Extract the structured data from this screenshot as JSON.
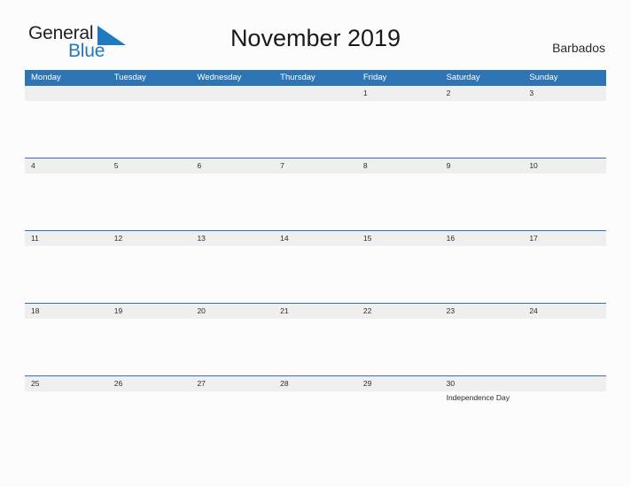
{
  "brand": {
    "name_part1": "General",
    "name_part2": "Blue",
    "flag_icon": "blue-triangle-flag-icon",
    "accent_color": "#1f7ac0"
  },
  "header": {
    "title": "November 2019",
    "locale": "Barbados"
  },
  "theme": {
    "header_blue": "#2e75b6",
    "band_gray": "#efeff0",
    "page_background": "#fcfcfc",
    "text_color": "#2b2b2b"
  },
  "calendar": {
    "month": "November",
    "year": "2019",
    "country": "Barbados",
    "weekdays": [
      "Monday",
      "Tuesday",
      "Wednesday",
      "Thursday",
      "Friday",
      "Saturday",
      "Sunday"
    ],
    "weeks": [
      [
        {
          "day": "",
          "events": []
        },
        {
          "day": "",
          "events": []
        },
        {
          "day": "",
          "events": []
        },
        {
          "day": "",
          "events": []
        },
        {
          "day": "1",
          "events": []
        },
        {
          "day": "2",
          "events": []
        },
        {
          "day": "3",
          "events": []
        }
      ],
      [
        {
          "day": "4",
          "events": []
        },
        {
          "day": "5",
          "events": []
        },
        {
          "day": "6",
          "events": []
        },
        {
          "day": "7",
          "events": []
        },
        {
          "day": "8",
          "events": []
        },
        {
          "day": "9",
          "events": []
        },
        {
          "day": "10",
          "events": []
        }
      ],
      [
        {
          "day": "11",
          "events": []
        },
        {
          "day": "12",
          "events": []
        },
        {
          "day": "13",
          "events": []
        },
        {
          "day": "14",
          "events": []
        },
        {
          "day": "15",
          "events": []
        },
        {
          "day": "16",
          "events": []
        },
        {
          "day": "17",
          "events": []
        }
      ],
      [
        {
          "day": "18",
          "events": []
        },
        {
          "day": "19",
          "events": []
        },
        {
          "day": "20",
          "events": []
        },
        {
          "day": "21",
          "events": []
        },
        {
          "day": "22",
          "events": []
        },
        {
          "day": "23",
          "events": []
        },
        {
          "day": "24",
          "events": []
        }
      ],
      [
        {
          "day": "25",
          "events": []
        },
        {
          "day": "26",
          "events": []
        },
        {
          "day": "27",
          "events": []
        },
        {
          "day": "28",
          "events": []
        },
        {
          "day": "29",
          "events": []
        },
        {
          "day": "30",
          "events": [
            "Independence Day"
          ]
        },
        {
          "day": "",
          "events": []
        }
      ]
    ]
  }
}
